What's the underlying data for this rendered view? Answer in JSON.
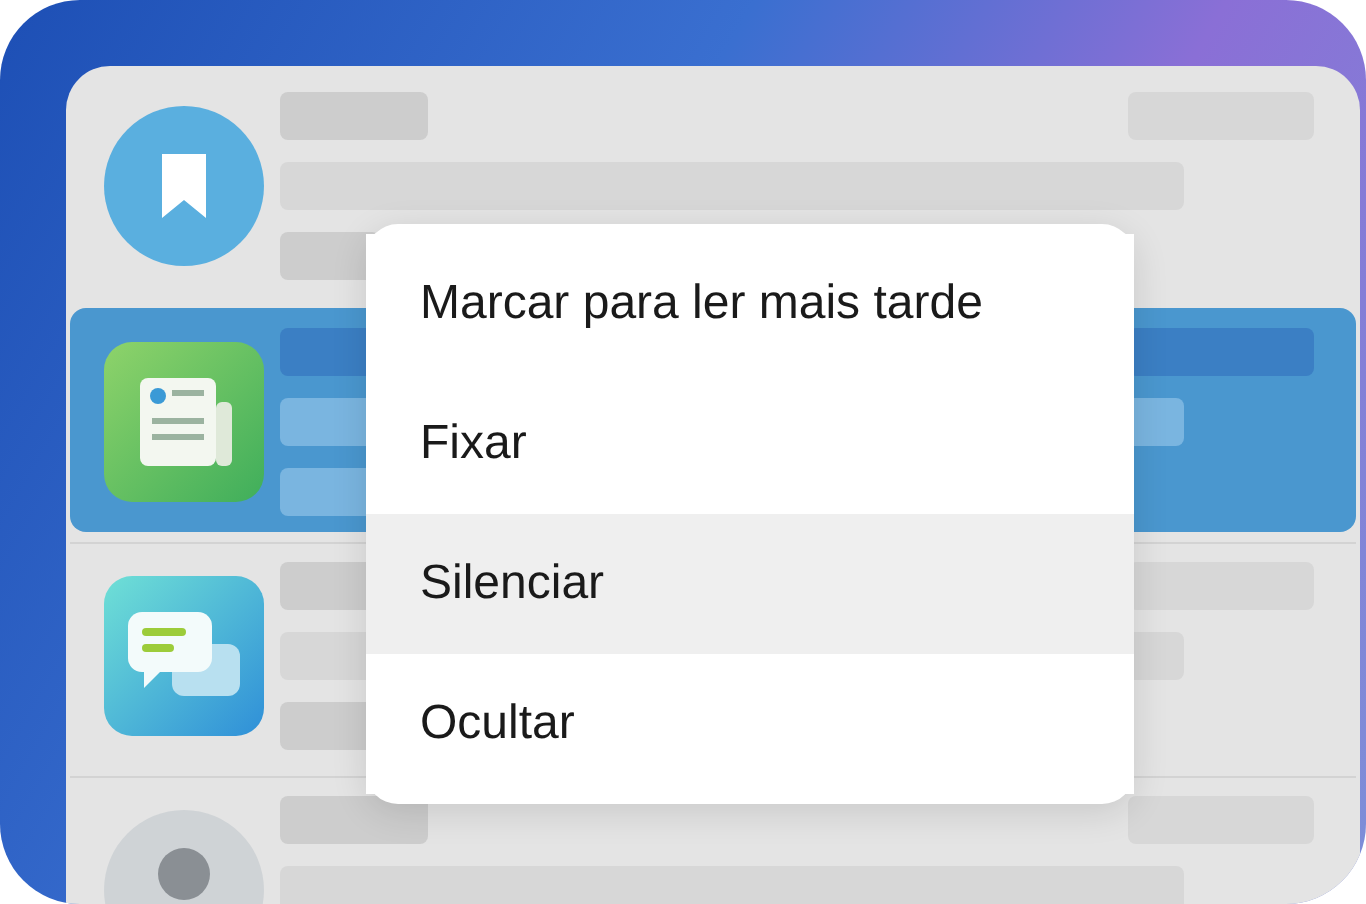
{
  "rows": [
    {
      "kind": "bookmark",
      "selected": false
    },
    {
      "kind": "newspaper",
      "selected": true
    },
    {
      "kind": "chat",
      "selected": false
    },
    {
      "kind": "avatar",
      "selected": false
    }
  ],
  "menu": {
    "items": [
      {
        "label": "Marcar para ler mais tarde",
        "selected": false
      },
      {
        "label": "Fixar",
        "selected": false
      },
      {
        "label": "Silenciar",
        "selected": true
      },
      {
        "label": "Ocultar",
        "selected": false
      }
    ]
  }
}
